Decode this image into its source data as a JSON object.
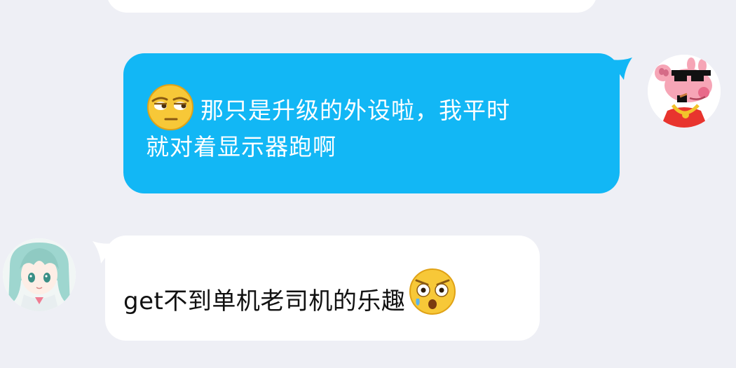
{
  "chat": {
    "messages": [
      {
        "direction": "outgoing",
        "bubble_color": "#12b7f5",
        "text_color": "#ffffff",
        "emoji": "smirk-face-icon",
        "line1": "那只是升级的外设啦，我平时",
        "line2": "就对着显示器跑啊",
        "avatar": "peppa-pig-sunglasses-avatar"
      },
      {
        "direction": "incoming",
        "bubble_color": "#ffffff",
        "text_color": "#111111",
        "text": "get不到单机老司机的乐趣",
        "emoji": "shocked-face-icon",
        "avatar": "anime-girl-avatar"
      }
    ]
  },
  "colors": {
    "background": "#eeeff5"
  }
}
